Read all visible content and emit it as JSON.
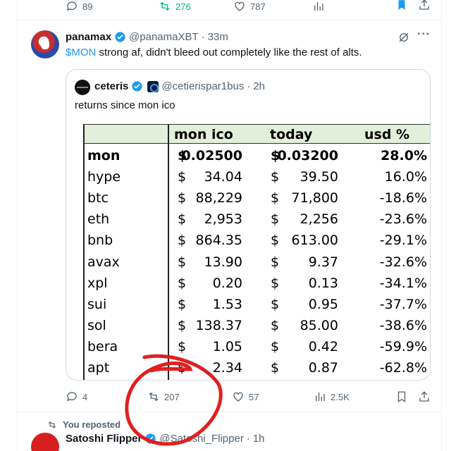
{
  "prev_tweet_actions": {
    "replies": "89",
    "reposts": "276",
    "likes": "787"
  },
  "tweet": {
    "name": "panamax",
    "handle": "@panamaXBT",
    "separator": "·",
    "time": "33m",
    "text_cashtag": "$MON",
    "text_rest": " strong af, didn't bleed out completely like the rest of alts.",
    "more_label": "···"
  },
  "quote": {
    "name": "ceteris",
    "handle": "@cetierispar1bus",
    "separator": "·",
    "time": "2h",
    "text": "returns since mon ico"
  },
  "sheet": {
    "headers": {
      "col1": "mon ico",
      "col2": "today",
      "col3": "usd %"
    },
    "currency": "$",
    "rows": [
      {
        "name": "mon",
        "ico": "0.02500",
        "today": "0.03200",
        "pct": "28.0%"
      },
      {
        "name": "hype",
        "ico": "34.04",
        "today": "39.50",
        "pct": "16.0%"
      },
      {
        "name": "btc",
        "ico": "88,229",
        "today": "71,800",
        "pct": "-18.6%"
      },
      {
        "name": "eth",
        "ico": "2,953",
        "today": "2,256",
        "pct": "-23.6%"
      },
      {
        "name": "bnb",
        "ico": "864.35",
        "today": "613.00",
        "pct": "-29.1%"
      },
      {
        "name": "avax",
        "ico": "13.90",
        "today": "9.37",
        "pct": "-32.6%"
      },
      {
        "name": "xpl",
        "ico": "0.20",
        "today": "0.13",
        "pct": "-34.1%"
      },
      {
        "name": "sui",
        "ico": "1.53",
        "today": "0.95",
        "pct": "-37.7%"
      },
      {
        "name": "sol",
        "ico": "138.37",
        "today": "85.00",
        "pct": "-38.6%"
      },
      {
        "name": "bera",
        "ico": "1.05",
        "today": "0.42",
        "pct": "-59.9%"
      },
      {
        "name": "apt",
        "ico": "2.34",
        "today": "0.87",
        "pct": "-62.8%"
      }
    ]
  },
  "tweet_actions": {
    "replies": "4",
    "reposts": "207",
    "likes": "57",
    "views": "2.5K"
  },
  "next": {
    "reposted_label": "You reposted",
    "name": "Satoshi Flipper",
    "handle": "@Satoshi_Flipper",
    "separator": "·",
    "time": "1h"
  },
  "colors": {
    "accent": "#1d9bf0",
    "repost_active": "#00ba7c",
    "annotation": "#e02020"
  }
}
